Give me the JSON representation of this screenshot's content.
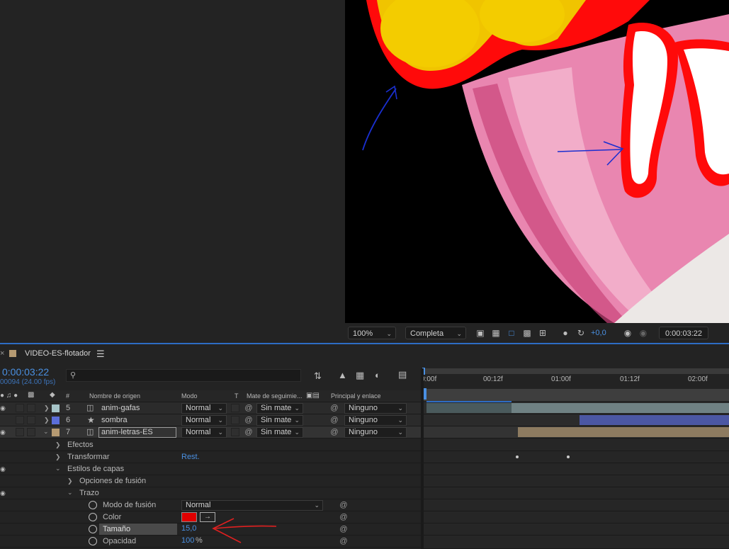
{
  "viewer": {
    "zoom": "100%",
    "resolution": "Completa",
    "exposure": "+0,0",
    "timecode": "0:00:03:22"
  },
  "composition": {
    "name": "VIDEO-ES-flotador",
    "menu_icon": "hamburger-icon"
  },
  "timeline": {
    "current_time": "0:00:03:22",
    "frame_info": "00094 (24.00 fps)",
    "search_placeholder": "",
    "ruler": [
      "0:00f",
      "00:12f",
      "01:00f",
      "01:12f",
      "02:00f"
    ],
    "columns": {
      "number": "#",
      "source_name": "Nombre de origen",
      "mode": "Modo",
      "t": "T",
      "track_matte": "Mate de seguimie...",
      "parent": "Principal y enlace"
    },
    "layers": [
      {
        "number": "5",
        "name": "anim-gafas",
        "mode": "Normal",
        "matte": "Sin mate",
        "parent": "Ninguno",
        "label_color": "#a6c4c8",
        "icon": "precomp-icon"
      },
      {
        "number": "6",
        "name": "sombra",
        "mode": "Normal",
        "matte": "Sin mate",
        "parent": "Ninguno",
        "label_color": "#5b6ed8",
        "icon": "star-icon"
      },
      {
        "number": "7",
        "name": "anim-letras-ES",
        "mode": "Normal",
        "matte": "Sin mate",
        "parent": "Ninguno",
        "label_color": "#b59a72",
        "icon": "precomp-icon"
      }
    ],
    "properties": {
      "effects": "Efectos",
      "transform": "Transformar",
      "transform_reset": "Rest.",
      "layer_styles": "Estilos de capas",
      "blending_options": "Opciones de fusión",
      "stroke": "Trazo",
      "blend_mode_label": "Modo de fusión",
      "blend_mode_value": "Normal",
      "color_label": "Color",
      "color_value": "#e00000",
      "size_label": "Tamaño",
      "size_value": "15,0",
      "opacity_label": "Opacidad",
      "opacity_value": "100",
      "opacity_unit": "%"
    }
  },
  "colors": {
    "accent": "#4a90e2",
    "panel_bg": "#232323",
    "annotation_red": "#e02020",
    "annotation_blue": "#1a2fd0"
  }
}
